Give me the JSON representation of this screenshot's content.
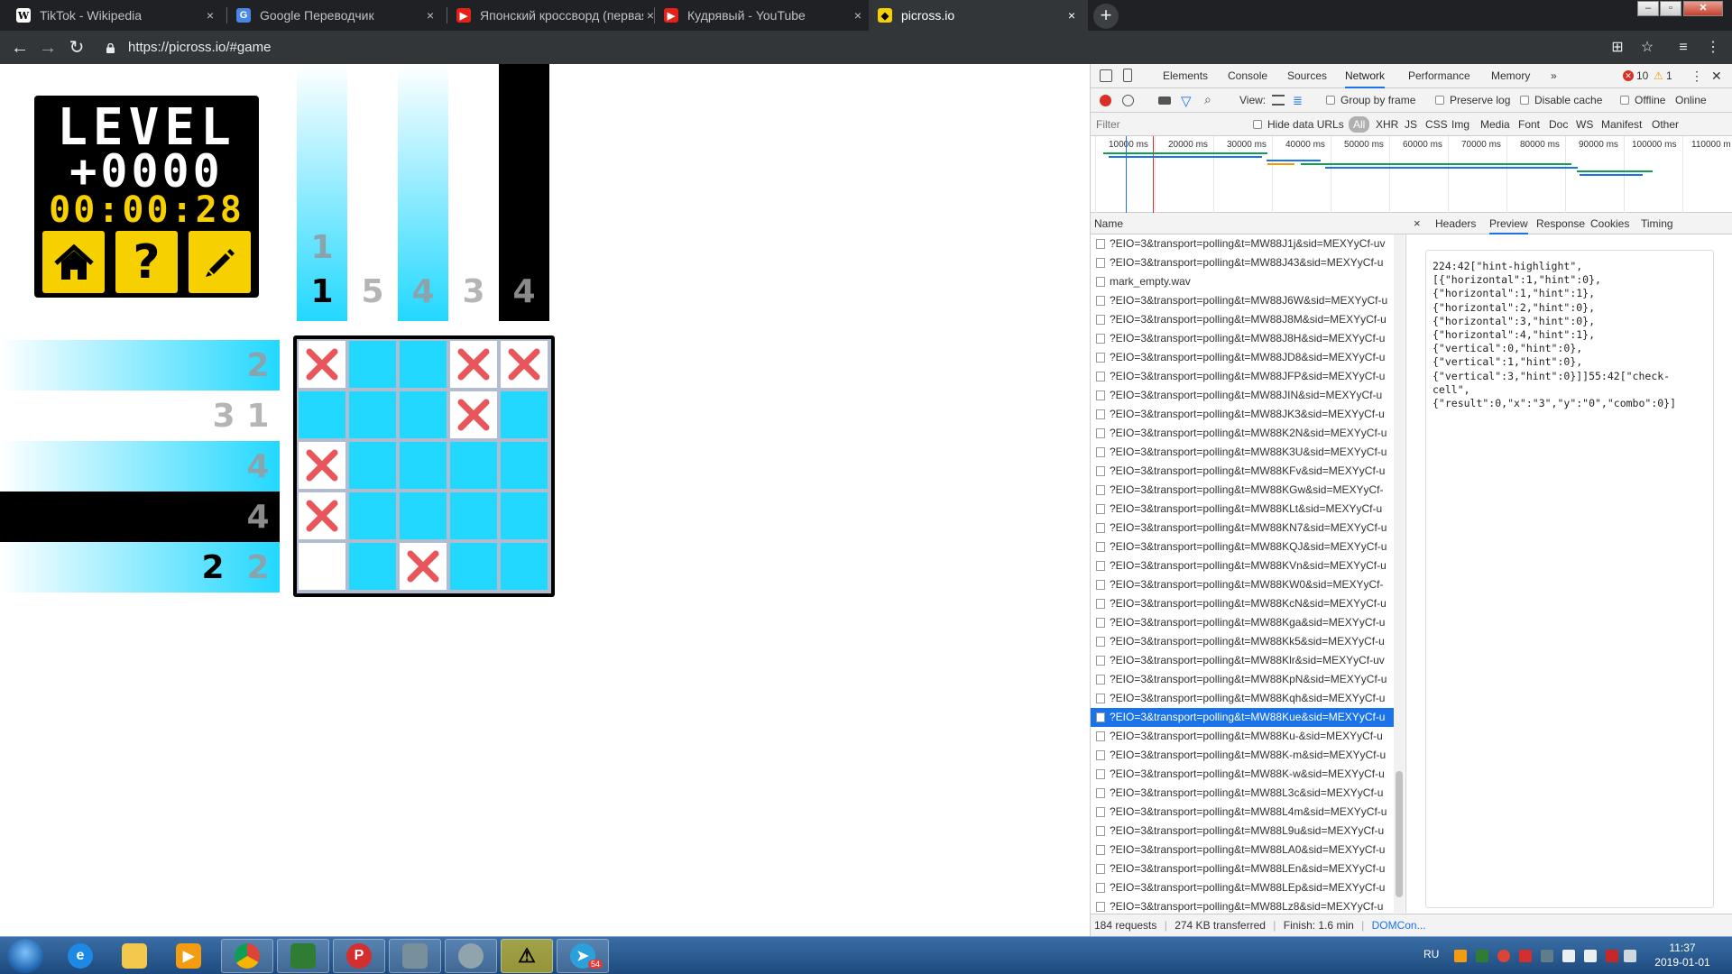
{
  "browser": {
    "tabs": [
      {
        "title": "TikTok - Wikipedia",
        "icon": "wikipedia-icon",
        "active": false
      },
      {
        "title": "Google Переводчик",
        "icon": "google-translate-icon",
        "active": false
      },
      {
        "title": "Японский кроссворд (первая с…",
        "icon": "youtube-icon",
        "active": false
      },
      {
        "title": "Кудрявый - YouTube",
        "icon": "youtube-icon",
        "active": false
      },
      {
        "title": "picross.io",
        "icon": "picross-icon",
        "active": true
      }
    ],
    "close_glyph": "×",
    "newtab_glyph": "+",
    "url": "https://picross.io/#game"
  },
  "game": {
    "logo_title": "LEVEL",
    "level_number": "+0000",
    "timer": "00:00:28",
    "buttons": {
      "home": "home",
      "help": "?",
      "edit": "edit"
    },
    "column_hints": [
      {
        "nums": [
          "1",
          "1"
        ],
        "done": [
          false,
          true
        ],
        "bar": "cyan"
      },
      {
        "nums": [
          "5"
        ],
        "done": [
          false
        ],
        "bar": "none"
      },
      {
        "nums": [
          "4"
        ],
        "done": [
          false
        ],
        "bar": "cyan"
      },
      {
        "nums": [
          "3"
        ],
        "done": [
          false
        ],
        "bar": "none"
      },
      {
        "nums": [
          "4"
        ],
        "done": [
          false
        ],
        "bar": "black"
      }
    ],
    "row_hints": [
      {
        "nums": [
          "2"
        ],
        "done": [
          false
        ],
        "bar": "cyan"
      },
      {
        "nums": [
          "3",
          "1"
        ],
        "done": [
          false,
          false
        ],
        "bar": "none"
      },
      {
        "nums": [
          "4"
        ],
        "done": [
          false
        ],
        "bar": "cyan"
      },
      {
        "nums": [
          "4"
        ],
        "done": [
          false
        ],
        "bar": "black"
      },
      {
        "nums": [
          "2",
          "2"
        ],
        "done": [
          true,
          false
        ],
        "bar": "cyan"
      }
    ],
    "grid": [
      [
        "x",
        "f",
        "f",
        "x",
        "x"
      ],
      [
        "f",
        "f",
        "f",
        "x",
        "f"
      ],
      [
        "x",
        "f",
        "f",
        "f",
        "f"
      ],
      [
        "x",
        "f",
        "f",
        "f",
        "f"
      ],
      [
        "e",
        "f",
        "x",
        "f",
        "f"
      ]
    ],
    "colors": {
      "fill": "#22d8ff",
      "mark": "#e8555a",
      "hint_pending": "#b5b5b5",
      "hint_done": "#000000"
    }
  },
  "devtools": {
    "tabs": [
      "Elements",
      "Console",
      "Sources",
      "Network",
      "Performance",
      "Memory"
    ],
    "more_tabs": "»",
    "active_tab": "Network",
    "errors": "10",
    "warnings": "1",
    "view_label": "View:",
    "group_by_frame": "Group by frame",
    "preserve_log": "Preserve log",
    "disable_cache": "Disable cache",
    "offline": "Offline",
    "online": "Online",
    "filter_placeholder": "Filter",
    "hide_data_urls": "Hide data URLs",
    "type_filters": [
      "All",
      "XHR",
      "JS",
      "CSS",
      "Img",
      "Media",
      "Font",
      "Doc",
      "WS",
      "Manifest",
      "Other"
    ],
    "timeline_ticks": [
      "10000 ms",
      "20000 ms",
      "30000 ms",
      "40000 ms",
      "50000 ms",
      "60000 ms",
      "70000 ms",
      "80000 ms",
      "90000 ms",
      "100000 ms",
      "110000 m"
    ],
    "name_header": "Name",
    "requests": [
      "?EIO=3&transport=polling&t=MW88J1j&sid=MEXYyCf-uv",
      "?EIO=3&transport=polling&t=MW88J43&sid=MEXYyCf-u",
      "mark_empty.wav",
      "?EIO=3&transport=polling&t=MW88J6W&sid=MEXYyCf-u",
      "?EIO=3&transport=polling&t=MW88J8M&sid=MEXYyCf-u",
      "?EIO=3&transport=polling&t=MW88J8H&sid=MEXYyCf-u",
      "?EIO=3&transport=polling&t=MW88JD8&sid=MEXYyCf-u",
      "?EIO=3&transport=polling&t=MW88JFP&sid=MEXYyCf-u",
      "?EIO=3&transport=polling&t=MW88JIN&sid=MEXYyCf-u",
      "?EIO=3&transport=polling&t=MW88JK3&sid=MEXYyCf-u",
      "?EIO=3&transport=polling&t=MW88K2N&sid=MEXYyCf-u",
      "?EIO=3&transport=polling&t=MW88K3U&sid=MEXYyCf-u",
      "?EIO=3&transport=polling&t=MW88KFv&sid=MEXYyCf-u",
      "?EIO=3&transport=polling&t=MW88KGw&sid=MEXYyCf-",
      "?EIO=3&transport=polling&t=MW88KLt&sid=MEXYyCf-u",
      "?EIO=3&transport=polling&t=MW88KN7&sid=MEXYyCf-u",
      "?EIO=3&transport=polling&t=MW88KQJ&sid=MEXYyCf-u",
      "?EIO=3&transport=polling&t=MW88KVn&sid=MEXYyCf-u",
      "?EIO=3&transport=polling&t=MW88KW0&sid=MEXYyCf-",
      "?EIO=3&transport=polling&t=MW88KcN&sid=MEXYyCf-u",
      "?EIO=3&transport=polling&t=MW88Kga&sid=MEXYyCf-u",
      "?EIO=3&transport=polling&t=MW88Kk5&sid=MEXYyCf-u",
      "?EIO=3&transport=polling&t=MW88Klr&sid=MEXYyCf-uv",
      "?EIO=3&transport=polling&t=MW88KpN&sid=MEXYyCf-u",
      "?EIO=3&transport=polling&t=MW88Kqh&sid=MEXYyCf-u",
      "?EIO=3&transport=polling&t=MW88Kue&sid=MEXYyCf-u",
      "?EIO=3&transport=polling&t=MW88Ku-&sid=MEXYyCf-u",
      "?EIO=3&transport=polling&t=MW88K-m&sid=MEXYyCf-u",
      "?EIO=3&transport=polling&t=MW88K-w&sid=MEXYyCf-u",
      "?EIO=3&transport=polling&t=MW88L3c&sid=MEXYyCf-u",
      "?EIO=3&transport=polling&t=MW88L4m&sid=MEXYyCf-u",
      "?EIO=3&transport=polling&t=MW88L9u&sid=MEXYyCf-u",
      "?EIO=3&transport=polling&t=MW88LA0&sid=MEXYyCf-u",
      "?EIO=3&transport=polling&t=MW88LEn&sid=MEXYyCf-u",
      "?EIO=3&transport=polling&t=MW88LEp&sid=MEXYyCf-u",
      "?EIO=3&transport=polling&t=MW88Lz8&sid=MEXYyCf-u"
    ],
    "selected_request_index": 25,
    "detail_close": "×",
    "detail_tabs": [
      "Headers",
      "Preview",
      "Response",
      "Cookies",
      "Timing"
    ],
    "active_detail_tab": "Preview",
    "preview_text": "224:42[\"hint-highlight\",\n[{\"horizontal\":1,\"hint\":0},\n{\"horizontal\":1,\"hint\":1},\n{\"horizontal\":2,\"hint\":0},\n{\"horizontal\":3,\"hint\":0},\n{\"horizontal\":4,\"hint\":1},\n{\"vertical\":0,\"hint\":0},\n{\"vertical\":1,\"hint\":0},\n{\"vertical\":3,\"hint\":0}]]55:42[\"check-\ncell\",\n{\"result\":0,\"x\":\"3\",\"y\":\"0\",\"combo\":0}]",
    "status_requests": "184 requests",
    "status_transferred": "274 KB transferred",
    "status_finish": "Finish: 1.6 min",
    "status_domcontent": "DOMCon..."
  },
  "taskbar": {
    "language": "RU",
    "time": "11:37",
    "date": "2019-01-01",
    "telegram_badge": "54"
  }
}
